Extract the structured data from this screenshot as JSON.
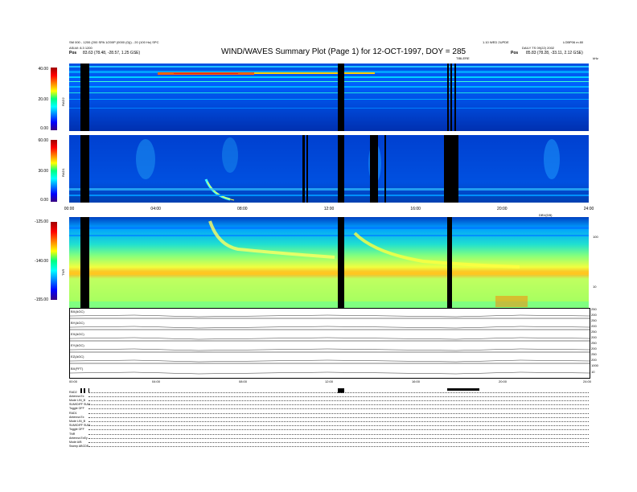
{
  "header": {
    "title": "WIND/WAVES Summary Plot (Page 1) for 12-OCT-1997, DOY = 285",
    "top_left_line1": "SM 000 - 1200 (200 SPA 1/200P (0000 (0))) - 20 (100 Hz) SPC",
    "top_left_line2": "ASLW: 8.3 1200",
    "top_left_pos_label": "Pos",
    "top_left_pos_value": "83.63 (78.48, -28.57, 1.25 GSE)",
    "top_right_line1": "LOBP06 m 80",
    "top_mid_right": "1.10 WED 2UPDE",
    "top_right_line2": "DAILY TS 09(22) 2002",
    "top_right_pos_label": "Pos",
    "top_right_pos_value": "85.83 (78.28, -33.11, 2.12 GSE)",
    "mid_tag": "TIBLERE",
    "khz_tag": "kHz"
  },
  "rad2": {
    "name": "RAD2",
    "y_ticks": [
      "40.00",
      "20.00",
      "0.00"
    ]
  },
  "rad1": {
    "name": "RAD1",
    "y_ticks": [
      "60.00",
      "30.00",
      "0.00"
    ]
  },
  "tnr": {
    "name": "TNR",
    "y_ticks": [
      "-125.00",
      "-140.00",
      "-155.00"
    ],
    "right_ticks": [
      "100",
      "10"
    ],
    "tag": "DBV(DB)"
  },
  "x_axis": {
    "ticks": [
      "00:00",
      "04:00",
      "08:00",
      "12:00",
      "16:00",
      "20:00",
      "24:00"
    ]
  },
  "line_panels": [
    {
      "name": "BX(AGC)",
      "r1": "250",
      "r2": "200"
    },
    {
      "name": "BY(AGC)",
      "r1": "250",
      "r2": "200"
    },
    {
      "name": "EX(AGC)",
      "r1": "250",
      "r2": "200"
    },
    {
      "name": "EY(AGC)",
      "r1": "250",
      "r2": "200"
    },
    {
      "name": "EZ(AGC)",
      "r1": "250",
      "r2": "200"
    },
    {
      "name": "BX(FFT)",
      "r1": "1000",
      "r2": "10"
    }
  ],
  "bottom_axis": {
    "ticks": [
      "00:00",
      "04:00",
      "08:00",
      "12:00",
      "16:00",
      "20:00",
      "24:00"
    ]
  },
  "params": [
    "RAD2",
    "Antenna  Ex",
    "Mode     LIN_B",
    "SUM/DIFF SUM",
    "Toggle   OFF",
    "RAD1",
    "Antenna  Ex",
    "Mode     LIN_B",
    "SUM/DIFF SUM",
    "Toggle   OFF",
    "TNR",
    "Antenna  ExEy",
    "Mode     A/B",
    "Sweep    ABCDE"
  ],
  "chart_data": {
    "type": "heatmap",
    "title": "WIND/WAVES Summary Plot (Page 1) for 12-OCT-1997, DOY = 285",
    "x_range_hours": [
      0,
      24
    ],
    "x_ticks": [
      "00:00",
      "04:00",
      "08:00",
      "12:00",
      "16:00",
      "20:00",
      "24:00"
    ],
    "panels": [
      {
        "name": "RAD2",
        "colorbar_range": [
          0,
          40
        ]
      },
      {
        "name": "RAD1",
        "colorbar_range": [
          0,
          60
        ]
      },
      {
        "name": "TNR",
        "colorbar_range": [
          -155,
          -125
        ],
        "right_axis": [
          "100",
          "10"
        ]
      }
    ],
    "data_gaps_hours": [
      [
        0.8,
        1.1
      ],
      [
        12.5,
        12.8
      ],
      [
        18.3,
        18.6
      ]
    ]
  }
}
